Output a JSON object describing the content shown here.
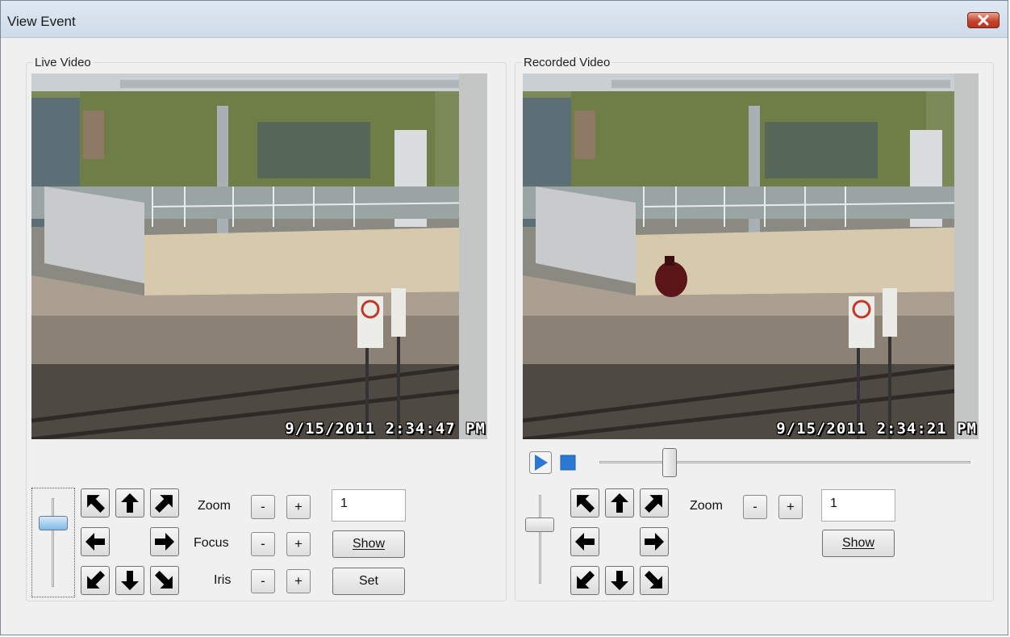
{
  "window": {
    "title": "View Event"
  },
  "live": {
    "group_label": "Live Video",
    "timestamp": "9/15/2011 2:34:47 PM",
    "zoom_label": "Zoom",
    "focus_label": "Focus",
    "iris_label": "Iris",
    "minus": "-",
    "plus": "+",
    "value": "1",
    "show_label": "Show",
    "set_label": "Set"
  },
  "recorded": {
    "group_label": "Recorded Video",
    "timestamp": "9/15/2011 2:34:21 PM",
    "zoom_label": "Zoom",
    "minus": "-",
    "plus": "+",
    "value": "1",
    "show_label": "Show",
    "playback_position": 0.19
  },
  "colors": {
    "accent": "#2a78d2",
    "title_bg": "#d6e1ee",
    "close": "#c7452c"
  }
}
